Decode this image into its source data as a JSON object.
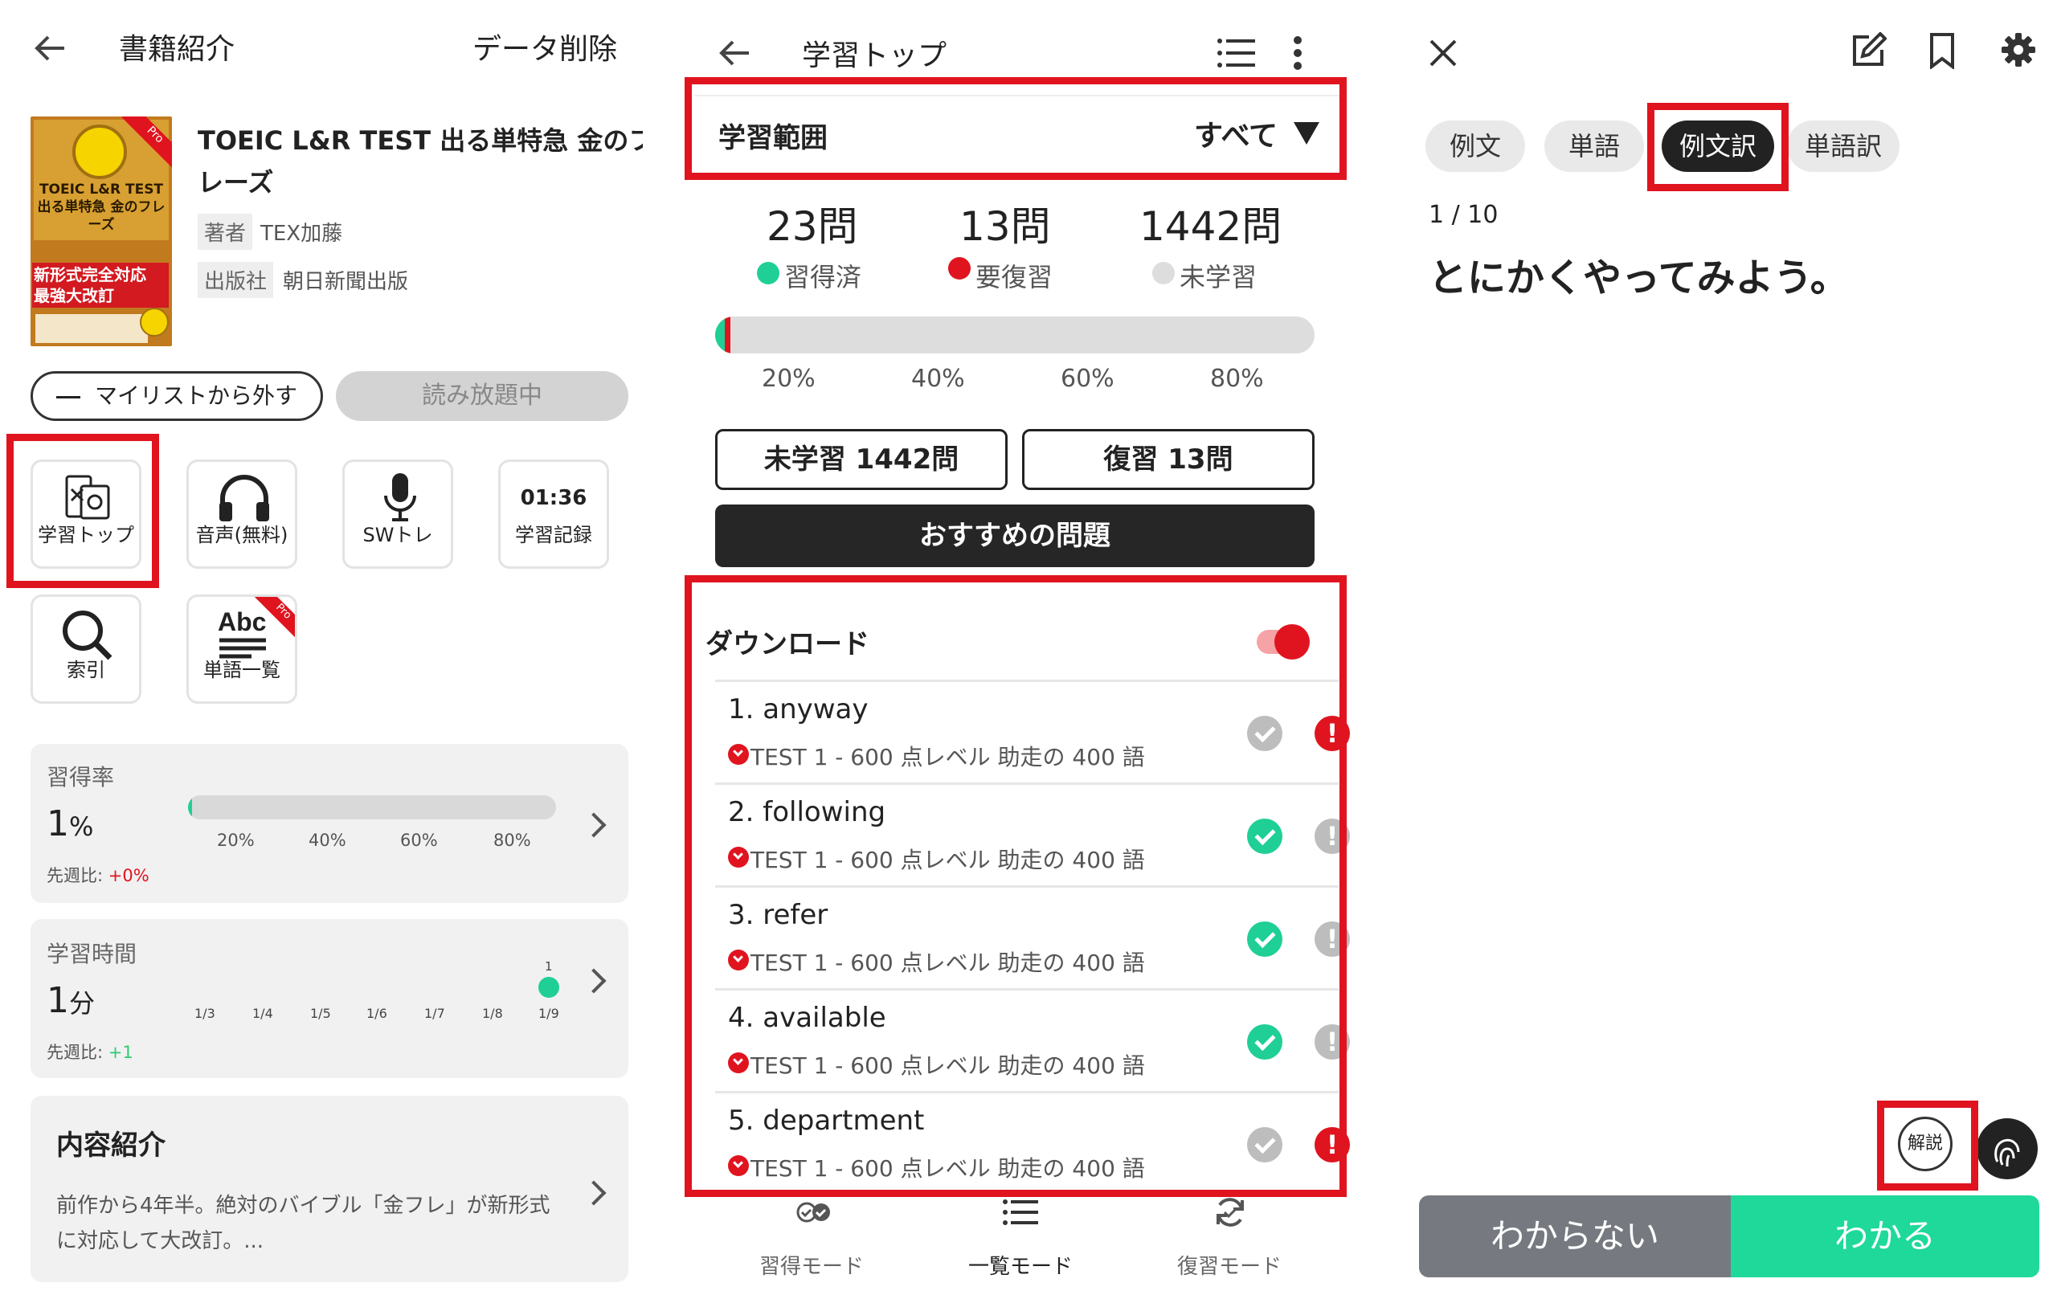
{
  "p1": {
    "header": {
      "title": "書籍紹介",
      "action": "データ削除"
    },
    "book": {
      "cover_title": "TOEIC L&R TEST 出る単特急 金のフレーズ",
      "cover_badge": "Pro",
      "cover_tag": "新形式完全対応 最強大改訂",
      "title_line1": "TOEIC L&R TEST 出る単特急 金のフ",
      "title_line2": "レーズ",
      "author_label": "著者",
      "author": "TEX加藤",
      "publisher_label": "出版社",
      "publisher": "朝日新聞出版"
    },
    "buttons": {
      "mylist": "マイリストから外す",
      "unlimited": "読み放題中"
    },
    "tiles": [
      {
        "label": "学習トップ",
        "icon": "study-top-icon"
      },
      {
        "label": "音声(無料)",
        "icon": "headphones-icon"
      },
      {
        "label": "SWトレ",
        "icon": "microphone-icon"
      },
      {
        "label": "学習記録",
        "value": "01:36"
      },
      {
        "label": "索引",
        "icon": "search-icon"
      },
      {
        "label": "単語一覧",
        "icon": "abc-list-icon",
        "badge": "Pro"
      }
    ],
    "mastery": {
      "title": "習得率",
      "value": "1",
      "unit": "%",
      "compare_label": "先週比:",
      "compare_value": "+0%",
      "ticks": [
        "20%",
        "40%",
        "60%",
        "80%"
      ],
      "progress": 0.01
    },
    "time": {
      "title": "学習時間",
      "value": "1",
      "unit": "分",
      "compare_label": "先週比:",
      "compare_value": "+1",
      "days": [
        "1/3",
        "1/4",
        "1/5",
        "1/6",
        "1/7",
        "1/8",
        "1/9"
      ],
      "point_label": "1",
      "values": [
        0,
        0,
        0,
        0,
        0,
        0,
        1
      ]
    },
    "intro": {
      "title": "内容紹介",
      "line1": "前作から4年半。絶対のバイブル「金フレ」が新形式",
      "line2": "に対応して大改訂。..."
    }
  },
  "p2": {
    "header": {
      "title": "学習トップ"
    },
    "range": {
      "label": "学習範囲",
      "value": "すべて"
    },
    "stats": [
      {
        "count": "23問",
        "label": "習得済",
        "color": "#1fcf96"
      },
      {
        "count": "13問",
        "label": "要復習",
        "color": "#e0141f"
      },
      {
        "count": "1442問",
        "label": "未学習",
        "color": "#dddddd"
      }
    ],
    "progress_ticks": [
      "20%",
      "40%",
      "60%",
      "80%"
    ],
    "progress": {
      "mastered": 0.016,
      "review": 0.009
    },
    "buttons": {
      "unlearned": "未学習 1442問",
      "review": "復習 13問",
      "recommended": "おすすめの問題"
    },
    "download": {
      "label": "ダウンロード",
      "on": true
    },
    "words": [
      {
        "word": "1. anyway",
        "sub": "TEST 1 - 600 点レベル 助走の 400 語",
        "done": false,
        "flag": true
      },
      {
        "word": "2. following",
        "sub": "TEST 1 - 600 点レベル 助走の 400 語",
        "done": true,
        "flag": false
      },
      {
        "word": "3. refer",
        "sub": "TEST 1 - 600 点レベル 助走の 400 語",
        "done": true,
        "flag": false
      },
      {
        "word": "4. available",
        "sub": "TEST 1 - 600 点レベル 助走の 400 語",
        "done": true,
        "flag": false
      },
      {
        "word": "5. department",
        "sub": "TEST 1 - 600 点レベル 助走の 400 語",
        "done": false,
        "flag": true
      }
    ],
    "bottom_nav": [
      {
        "label": "習得モード",
        "icon": "mastery-mode-icon"
      },
      {
        "label": "一覧モード",
        "icon": "list-mode-icon"
      },
      {
        "label": "復習モード",
        "icon": "review-mode-icon"
      }
    ]
  },
  "p3": {
    "tabs": [
      "例文",
      "単語",
      "例文訳",
      "単語訳"
    ],
    "active_tab": "例文訳",
    "counter": "1 / 10",
    "sentence": "とにかくやってみよう。",
    "explain": "解説",
    "buttons": {
      "unknown": "わからない",
      "known": "わかる"
    }
  },
  "colors": {
    "highlight": "#e0141f",
    "mastered": "#1fcf96",
    "review": "#e0141f",
    "positive": "#2ecc71",
    "negative": "#e0141f",
    "dark_button": "#262626",
    "unknown_button": "#767a80",
    "known_button": "#1fd99a"
  }
}
